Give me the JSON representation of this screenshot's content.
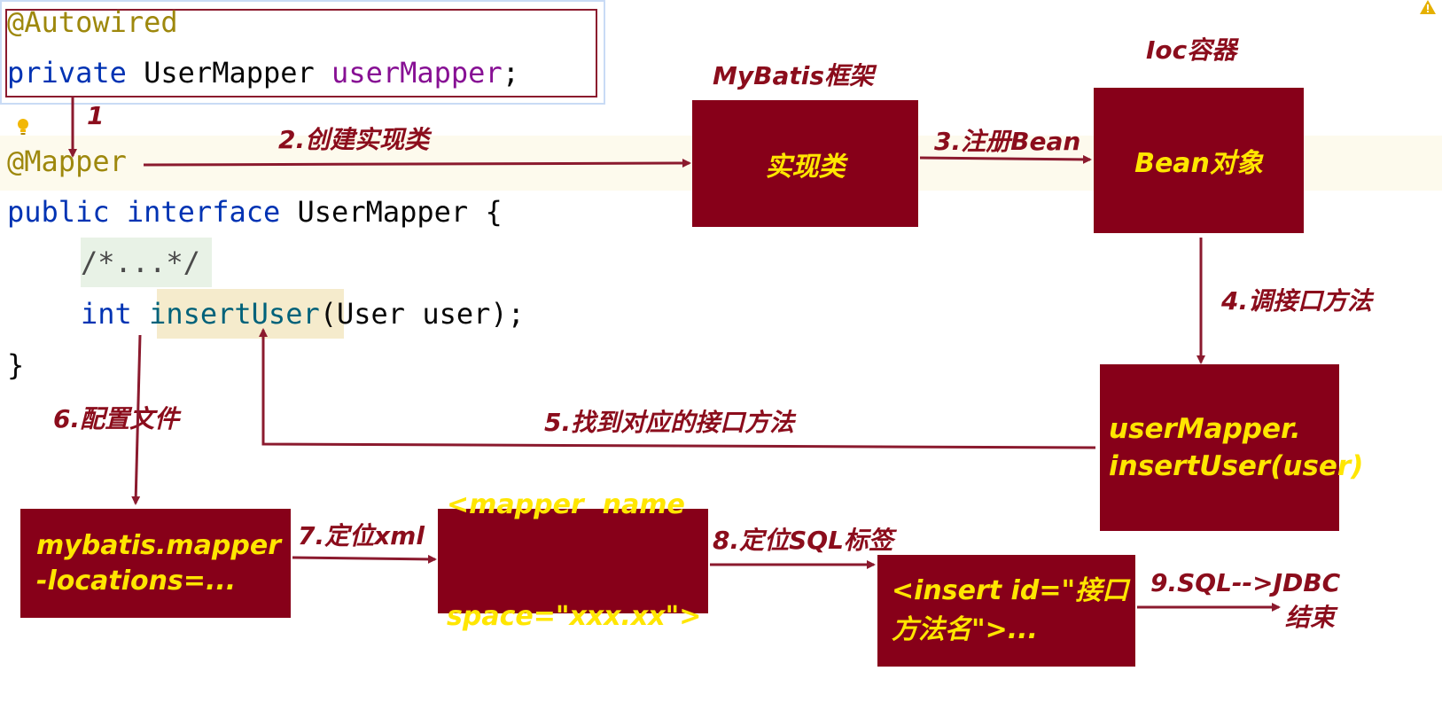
{
  "code": {
    "autowired": "@Autowired",
    "private_kw": "private",
    "field_type": "UserMapper",
    "field_name": "userMapper",
    "semicolon": ";",
    "mapper_annotation": "@Mapper",
    "public_kw": "public",
    "interface_kw": "interface",
    "interface_name": "UserMapper",
    "open_brace": "{",
    "folded_comment": "/*...*/",
    "int_kw": "int",
    "method_name": "insertUser",
    "method_params": "(User user);",
    "close_brace": "}"
  },
  "boxes": {
    "impl_class": "实现类",
    "bean_object": "Bean对象",
    "call_expr_line1": "userMapper.",
    "call_expr_line2": "insertUser(user)",
    "mapper_locations_line1": "mybatis.mapper",
    "mapper_locations_line2": "-locations=...",
    "namespace_line1": "<mapper  name",
    "namespace_line2": "space=\"xxx.xx\">",
    "insert_tag_line1": "<insert id=\"接口",
    "insert_tag_line2": "方法名\">..."
  },
  "labels": {
    "step1": "1",
    "step2": "2.创建实现类",
    "mybatis_framework": "MyBatis框架",
    "ioc_container": "Ioc容器",
    "step3": "3.注册Bean",
    "step4": "4.调接口方法",
    "step5": "5.找到对应的接口方法",
    "step6": "6.配置文件",
    "step7": "7.定位xml",
    "step8": "8.定位SQL标签",
    "step9_line1": "9.SQL-->JDBC",
    "step9_line2": "结束"
  },
  "colors": {
    "box_fill": "#870019",
    "box_text": "#ffe600",
    "label_text": "#8b0d1c",
    "arrow": "#8b1a2e"
  }
}
